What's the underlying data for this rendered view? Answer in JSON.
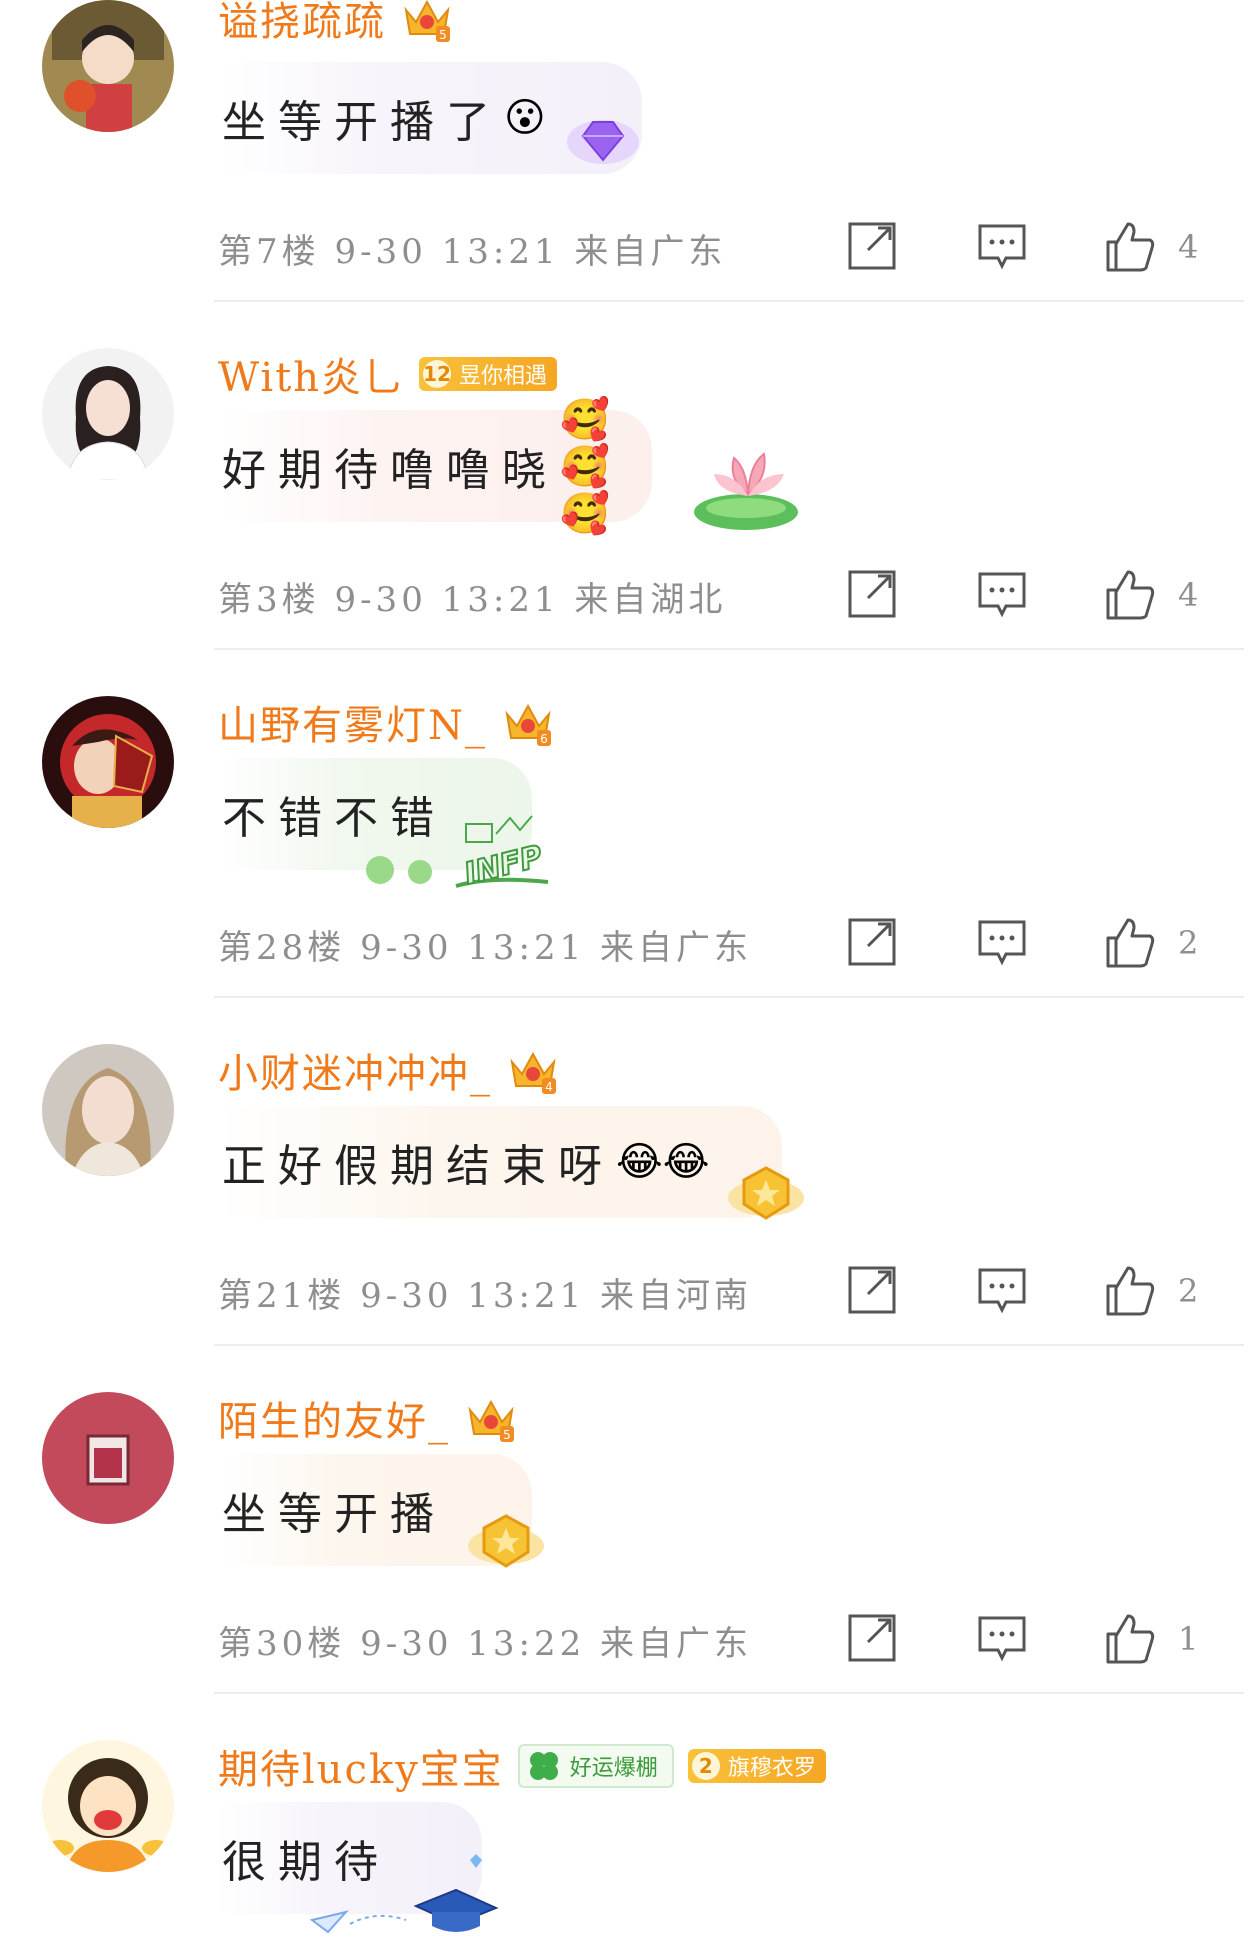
{
  "comments": [
    {
      "username": "谥挠疏疏",
      "text": "坐等开播了",
      "emoji": "😮",
      "meta": "第7楼 9-30 13:21 来自广东",
      "likes": "4",
      "crown_level": "5"
    },
    {
      "username": "With炎乚",
      "badge_level": "12",
      "badge_label": "昱你相遇",
      "text": "好期待噜噜晓",
      "emoji": "🥰🥰🥰",
      "meta": "第3楼 9-30 13:21 来自湖北",
      "likes": "4"
    },
    {
      "username": "山野有雾灯N_",
      "text": "不错不错",
      "deco_text": "INFP",
      "meta": "第28楼 9-30 13:21 来自广东",
      "likes": "2",
      "crown_level": "6"
    },
    {
      "username": "小财迷冲冲冲_",
      "text": "正好假期结束呀",
      "emoji": "😂😂",
      "meta": "第21楼 9-30 13:21 来自河南",
      "likes": "2",
      "crown_level": "4"
    },
    {
      "username": "陌生的友好_",
      "text": "坐等开播",
      "meta": "第30楼 9-30 13:22 来自广东",
      "likes": "1",
      "crown_level": "5"
    },
    {
      "username": "期待lucky宝宝",
      "badge_green_label": "好运爆棚",
      "badge_level": "2",
      "badge_label": "旗穆衣罗",
      "text": "很期待"
    }
  ],
  "colors": {
    "username": "#f07a1a",
    "meta": "#8e8e8e",
    "divider": "#ececec",
    "badge": "#f5a623"
  },
  "icons": [
    "share-icon",
    "reply-icon",
    "thumbs-up-icon",
    "crown-icon"
  ]
}
